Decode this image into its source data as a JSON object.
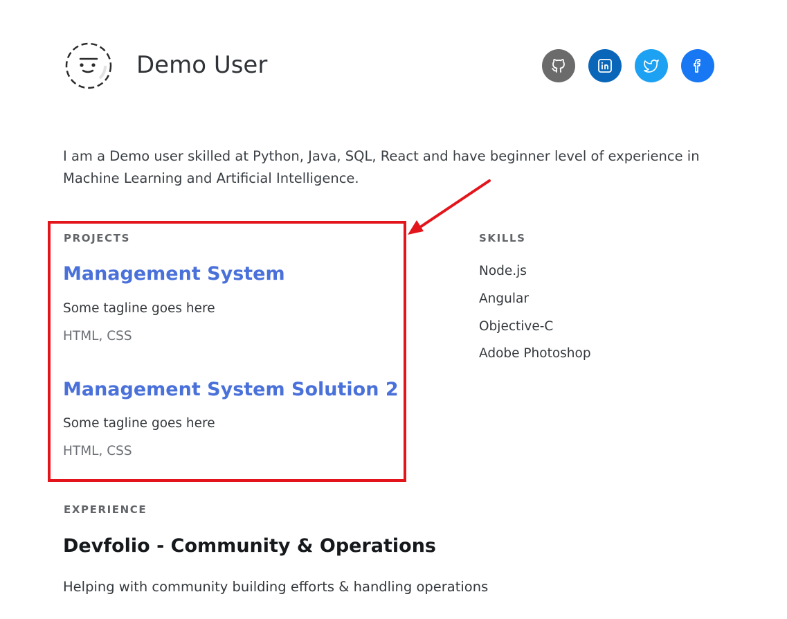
{
  "header": {
    "name": "Demo User"
  },
  "socials": [
    {
      "icon": "github-icon",
      "color": "#6b6b6b"
    },
    {
      "icon": "linkedin-icon",
      "color": "#0a66b8"
    },
    {
      "icon": "twitter-icon",
      "color": "#1da1f2"
    },
    {
      "icon": "facebook-icon",
      "color": "#1877f2"
    }
  ],
  "bio": "I am a Demo user skilled at Python, Java, SQL, React and have beginner level of experience in Machine Learning and Artificial Intelligence.",
  "projects": {
    "label": "PROJECTS",
    "items": [
      {
        "title": "Management System",
        "tagline": "Some tagline goes here",
        "tech": "HTML, CSS"
      },
      {
        "title": "Management System Solution 2",
        "tagline": "Some tagline goes here",
        "tech": "HTML, CSS"
      }
    ]
  },
  "skills": {
    "label": "SKILLS",
    "items": [
      "Node.js",
      "Angular",
      "Objective-C",
      "Adobe Photoshop"
    ]
  },
  "experience": {
    "label": "EXPERIENCE",
    "items": [
      {
        "title": "Devfolio - Community & Operations",
        "description": "Helping with community building efforts & handling operations"
      }
    ]
  },
  "colors": {
    "accent": "#4a71da",
    "highlight": "#e3151b"
  }
}
